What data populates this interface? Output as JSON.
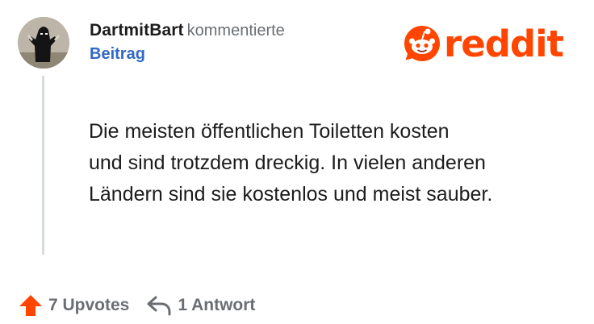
{
  "comment": {
    "author": "DartmitBart",
    "action": "kommentierte",
    "post_link": "Beitrag",
    "body_lines": [
      "Die meisten öffentlichen Toiletten kosten",
      "und sind trotzdem dreckig. In vielen anderen",
      "Ländern sind sie kostenlos und meist sauber."
    ]
  },
  "brand": {
    "wordmark": "reddit",
    "icon": "reddit-snoo-icon",
    "color": "#ff4500"
  },
  "footer": {
    "upvotes_label": "7 Upvotes",
    "upvote_icon": "upvote-arrow-icon",
    "upvote_color": "#ff4500",
    "replies_label": "1 Antwort",
    "reply_icon": "reply-arrow-icon"
  },
  "colors": {
    "link": "#3168c5",
    "muted": "#6a6e73",
    "text": "#1c1c1c"
  }
}
